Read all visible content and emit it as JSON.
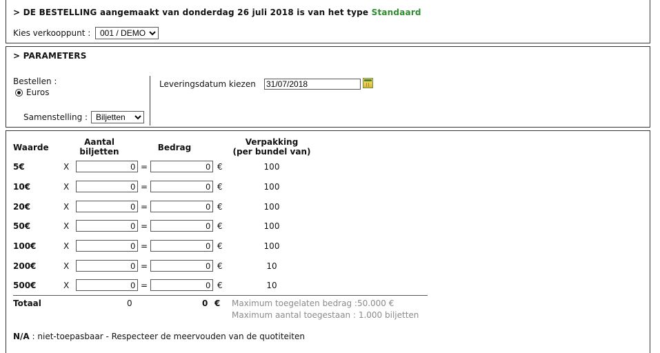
{
  "order_header": {
    "prefix": "> DE BESTELLING aangemaakt van donderdag 26 juli 2018 is van het type",
    "type": "Standaard"
  },
  "sales_point": {
    "label": "Kies verkooppunt :",
    "selected": "001 / DEMO"
  },
  "parameters": {
    "title": "> PARAMETERS",
    "order_label": "Bestellen :",
    "radio_label": "Euros",
    "composition_label": "Samenstelling :",
    "composition_selected": "Biljetten",
    "delivery_label": "Leveringsdatum kiezen",
    "delivery_date": "31/07/2018"
  },
  "table": {
    "headers": {
      "value": "Waarde",
      "count_line1": "Aantal",
      "count_line2": "biljetten",
      "amount": "Bedrag",
      "pack_line1": "Verpakking",
      "pack_line2": "(per bundel van)"
    },
    "rows": [
      {
        "denomination": "5€",
        "x": "X",
        "quantity": "0",
        "eq": "=",
        "amount": "0",
        "currency": "€",
        "packaging": "100"
      },
      {
        "denomination": "10€",
        "x": "X",
        "quantity": "0",
        "eq": "=",
        "amount": "0",
        "currency": "€",
        "packaging": "100"
      },
      {
        "denomination": "20€",
        "x": "X",
        "quantity": "0",
        "eq": "=",
        "amount": "0",
        "currency": "€",
        "packaging": "100"
      },
      {
        "denomination": "50€",
        "x": "X",
        "quantity": "0",
        "eq": "=",
        "amount": "0",
        "currency": "€",
        "packaging": "100"
      },
      {
        "denomination": "100€",
        "x": "X",
        "quantity": "0",
        "eq": "=",
        "amount": "0",
        "currency": "€",
        "packaging": "100"
      },
      {
        "denomination": "200€",
        "x": "X",
        "quantity": "0",
        "eq": "=",
        "amount": "0",
        "currency": "€",
        "packaging": "10"
      },
      {
        "denomination": "500€",
        "x": "X",
        "quantity": "0",
        "eq": "=",
        "amount": "0",
        "currency": "€",
        "packaging": "10"
      }
    ],
    "total": {
      "label": "Totaal",
      "quantity": "0",
      "amount": "0",
      "currency": "€",
      "max_amount": "Maximum toegelaten bedrag :50.000 €",
      "max_count": "Maximum aantal toegestaan : 1.000 biljetten"
    }
  },
  "footnote": {
    "abbr": "N/A",
    "text": " : niet-toepasbaar - Respecteer de meervouden van de quotiteiten"
  }
}
